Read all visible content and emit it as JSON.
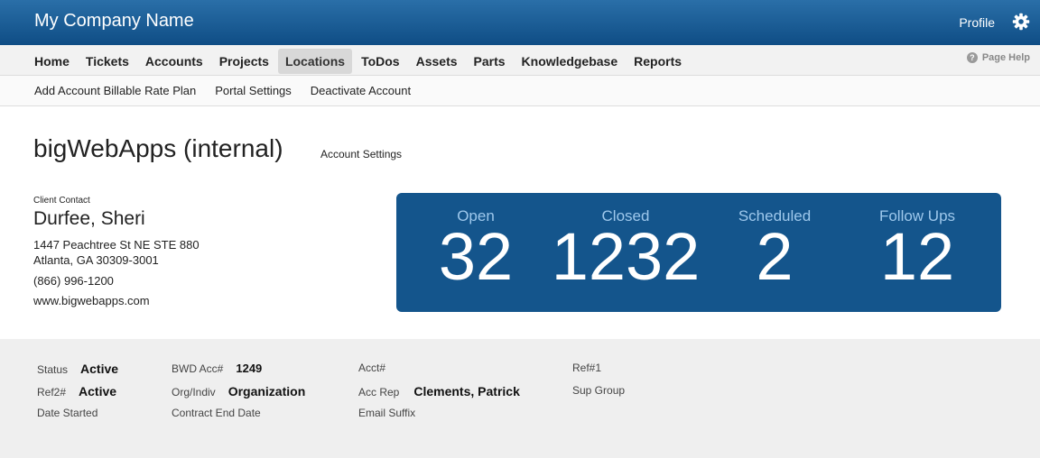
{
  "header": {
    "brand": "My Company Name",
    "profile": "Profile"
  },
  "nav": {
    "items": [
      "Home",
      "Tickets",
      "Accounts",
      "Projects",
      "Locations",
      "ToDos",
      "Assets",
      "Parts",
      "Knowledgebase",
      "Reports"
    ],
    "active": "Locations",
    "page_help": "Page Help"
  },
  "subnav": [
    "Add Account Billable Rate Plan",
    "Portal Settings",
    "Deactivate Account"
  ],
  "account": {
    "title": "bigWebApps (internal)",
    "settings_link": "Account Settings"
  },
  "contact": {
    "label": "Client Contact",
    "name": "Durfee, Sheri",
    "address_line1": "1447 Peachtree St NE STE 880",
    "address_line2": "Atlanta, GA 30309-3001",
    "phone": "(866) 996-1200",
    "website": "www.bigwebapps.com"
  },
  "stats": [
    {
      "label": "Open",
      "value": "32"
    },
    {
      "label": "Closed",
      "value": "1232"
    },
    {
      "label": "Scheduled",
      "value": "2"
    },
    {
      "label": "Follow Ups",
      "value": "12"
    }
  ],
  "details": {
    "status": {
      "label": "Status",
      "value": "Active"
    },
    "bwd_acc": {
      "label": "BWD Acc#",
      "value": "1249"
    },
    "acct": {
      "label": "Acct#",
      "value": ""
    },
    "ref1": {
      "label": "Ref#1",
      "value": ""
    },
    "ref2": {
      "label": "Ref2#",
      "value": "Active"
    },
    "org_indiv": {
      "label": "Org/Indiv",
      "value": "Organization"
    },
    "acc_rep": {
      "label": "Acc Rep",
      "value": "Clements, Patrick"
    },
    "sup_group": {
      "label": "Sup Group",
      "value": ""
    },
    "date_started": {
      "label": "Date Started",
      "value": ""
    },
    "contract_end": {
      "label": "Contract End Date",
      "value": ""
    },
    "email_suffix": {
      "label": "Email Suffix",
      "value": ""
    }
  },
  "colors": {
    "header": "#0f4d85",
    "stats_bg": "#14558c",
    "stats_label": "#9ec8ec",
    "panel_bg": "#efefef"
  }
}
